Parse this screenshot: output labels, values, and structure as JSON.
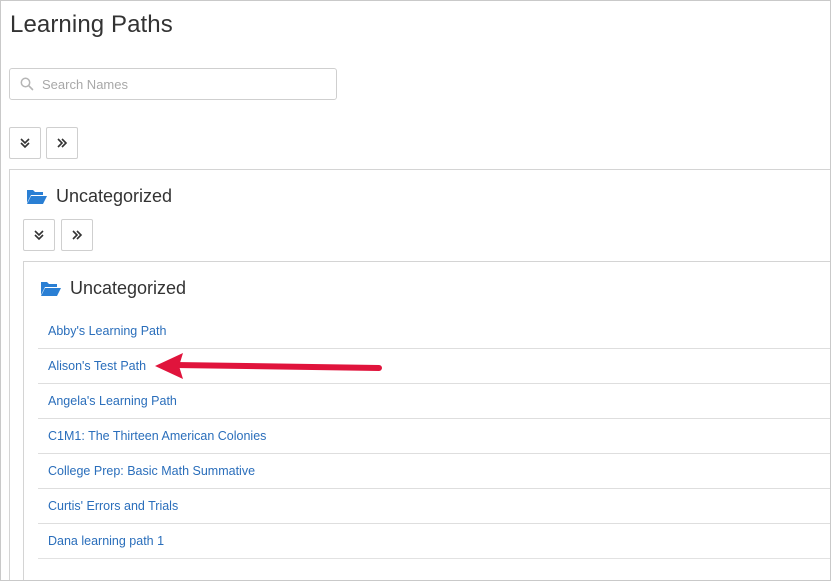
{
  "page": {
    "title": "Learning Paths"
  },
  "search": {
    "placeholder": "Search Names"
  },
  "toolbar": {
    "expand_all_icon": "double-chevron-down-icon",
    "expand_icon": "double-chevron-right-icon"
  },
  "groups": [
    {
      "name": "Uncategorized",
      "icon": "folder-open-icon"
    },
    {
      "name": "Uncategorized",
      "icon": "folder-open-icon"
    }
  ],
  "paths": [
    "Abby's Learning Path",
    "Alison's Test Path",
    "Angela's Learning Path",
    "C1M1: The Thirteen American Colonies",
    "College Prep: Basic Math Summative",
    "Curtis' Errors and Trials",
    "Dana learning path 1"
  ],
  "colors": {
    "link": "#2a6ebb",
    "folder": "#2a7fd4",
    "annotation_arrow": "#e0143c"
  }
}
